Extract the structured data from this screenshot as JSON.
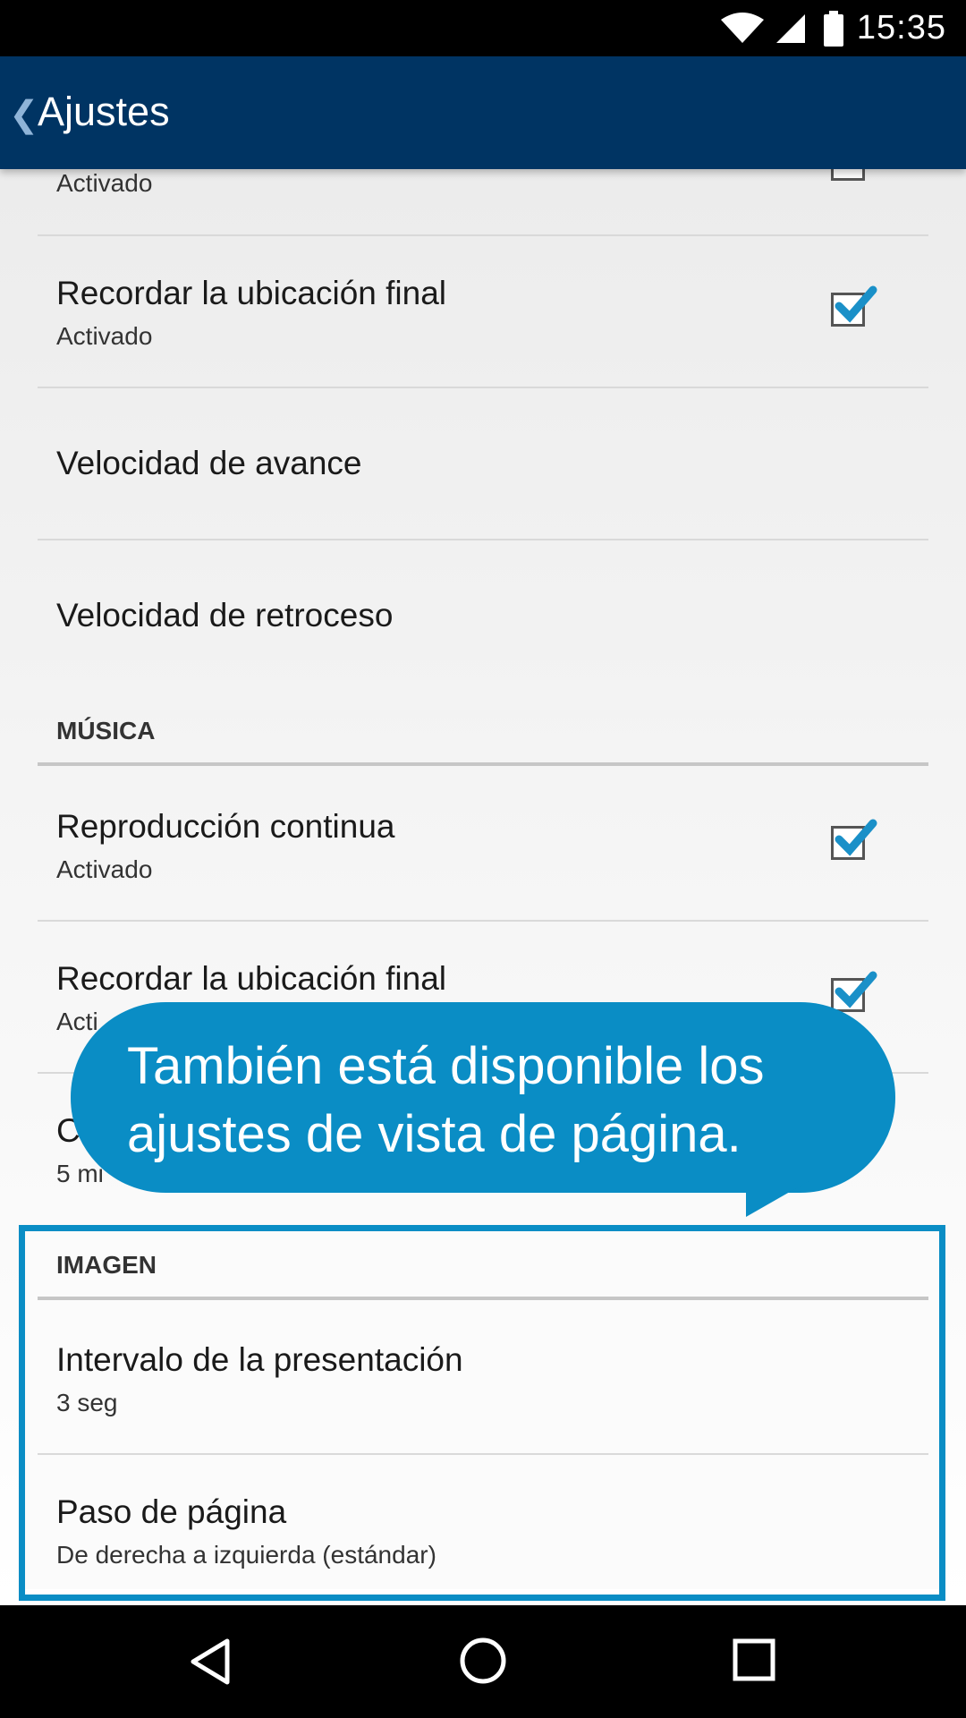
{
  "status": {
    "time": "15:35"
  },
  "appbar": {
    "title": "Ajustes",
    "back_glyph": "❮"
  },
  "rows": {
    "partial_secondary": "Activado",
    "remember1_primary": "Recordar la ubicación final",
    "remember1_secondary": "Activado",
    "forward_primary": "Velocidad de avance",
    "rewind_primary": "Velocidad de retroceso",
    "music_header": "MÚSICA",
    "continuous_primary": "Reproducción continua",
    "continuous_secondary": "Activado",
    "remember2_primary": "Recordar la ubicación final",
    "remember2_secondary": "Acti",
    "partial2_primary": "C",
    "partial2_secondary": "5 mi",
    "image_header": "IMAGEN",
    "interval_primary": "Intervalo de la presentación",
    "interval_secondary": "3 seg",
    "pagestep_primary": "Paso de página",
    "pagestep_secondary": "De derecha a izquierda (estándar)"
  },
  "callout": {
    "text": "También está disponible los ajustes de vista de página."
  },
  "colors": {
    "appbar": "#003463",
    "accent": "#0a8dc5",
    "check": "#1a90c8"
  }
}
